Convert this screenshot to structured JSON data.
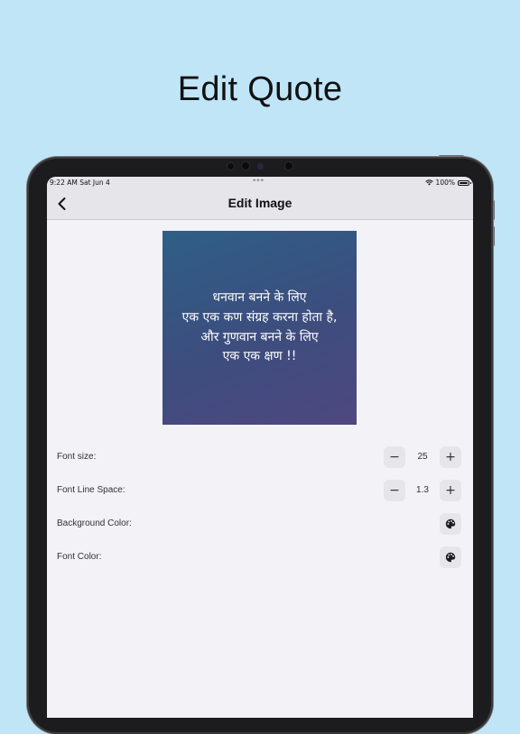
{
  "promo": {
    "title": "Edit Quote"
  },
  "status_bar": {
    "time_date": "9:22 AM   Sat Jun 4",
    "battery": "100%",
    "icons": [
      "wifi-icon",
      "battery-icon"
    ]
  },
  "nav": {
    "title": "Edit Image",
    "back_icon": "chevron-left-icon"
  },
  "quote": {
    "text": "धनवान बनने के लिए\nएक एक कण संग्रह करना होता है,\nऔर गुणवान बनने के लिए\nएक एक क्षण !!",
    "gradient_start": "#2e5f86",
    "gradient_end": "#4f4780",
    "text_color": "#ffffff"
  },
  "settings": {
    "font_size": {
      "label": "Font size:",
      "value": "25",
      "decrement": "−",
      "increment": "+"
    },
    "line_space": {
      "label": "Font Line Space:",
      "value": "1.3",
      "decrement": "−",
      "increment": "+"
    },
    "background_color": {
      "label": "Background Color:",
      "icon": "palette-icon"
    },
    "font_color": {
      "label": "Font Color:",
      "icon": "palette-icon"
    }
  },
  "colors": {
    "page_background": "#bfe5f7",
    "screen_background": "#f2f2f7",
    "bar_background": "#e5e5ea"
  }
}
